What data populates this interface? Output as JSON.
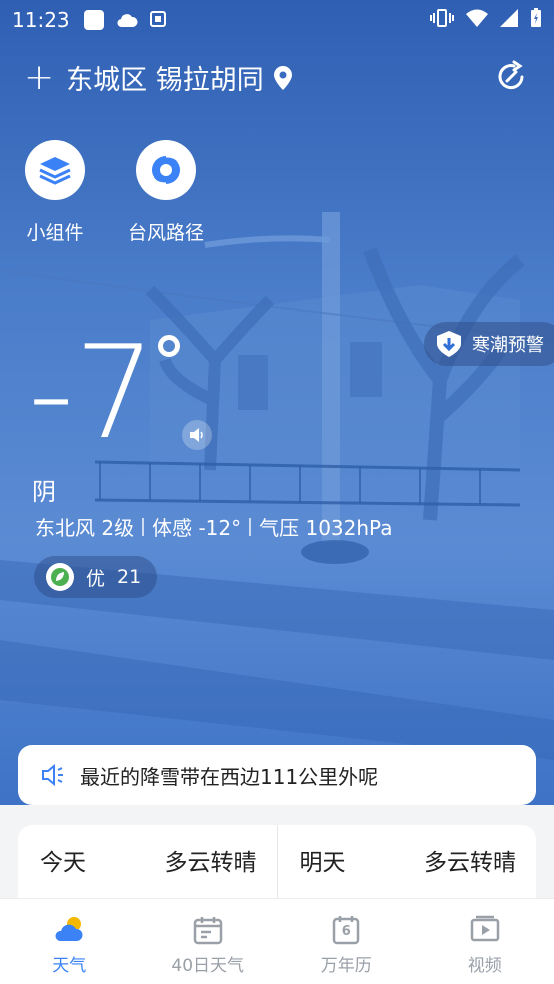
{
  "status_bar": {
    "time": "11:23"
  },
  "header": {
    "location": "东城区 锡拉胡同"
  },
  "shortcuts": [
    {
      "label": "小组件",
      "icon": "layers-icon"
    },
    {
      "label": "台风路径",
      "icon": "typhoon-icon"
    }
  ],
  "alert": {
    "label": "寒潮预警"
  },
  "current": {
    "temperature": "-7",
    "condition": "阴",
    "wind": "东北风 2级",
    "feels_like": "体感 -12°",
    "pressure": "气压 1032hPa",
    "aqi_label": "优",
    "aqi_value": "21"
  },
  "notice": {
    "text": "最近的降雪带在西边111公里外呢"
  },
  "forecast": [
    {
      "day": "今天",
      "condition": "多云转晴"
    },
    {
      "day": "明天",
      "condition": "多云转晴"
    }
  ],
  "tabs": [
    {
      "label": "天气",
      "active": true
    },
    {
      "label": "40日天气",
      "active": false
    },
    {
      "label": "万年历",
      "active": false,
      "calendar_day": "6"
    },
    {
      "label": "视频",
      "active": false
    }
  ],
  "colors": {
    "accent": "#3b82f6",
    "sky": "#4a7dca",
    "aqi_green": "#4caf50"
  }
}
